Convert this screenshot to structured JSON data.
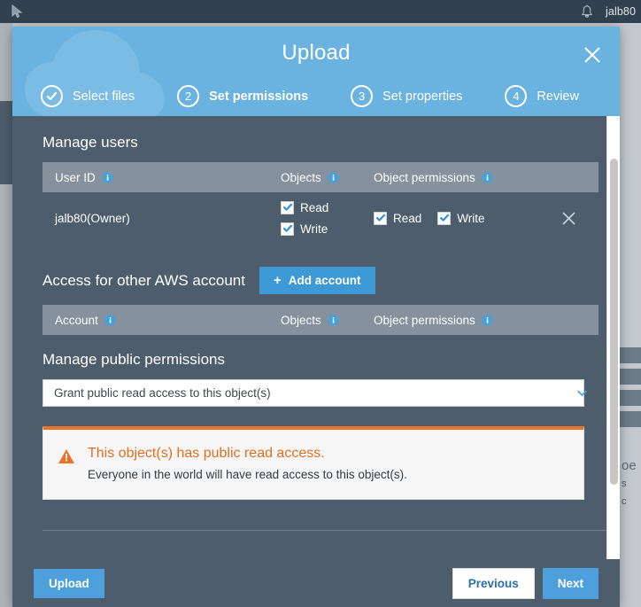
{
  "topbar": {
    "cursor_icon": "cursor-icon",
    "bell_icon": "bell-icon",
    "user": "jalb80"
  },
  "background": {
    "text_fragment_1": "oe",
    "text_fragment_2": "s",
    "text_fragment_3": "c"
  },
  "modal": {
    "title": "Upload",
    "close_icon": "close-icon",
    "watermark_icon": "cloud-upload-icon",
    "steps": [
      {
        "marker": "✓",
        "label": "Select files",
        "state": "done"
      },
      {
        "marker": "2",
        "label": "Set permissions",
        "state": "active"
      },
      {
        "marker": "3",
        "label": "Set properties",
        "state": "upcoming"
      },
      {
        "marker": "4",
        "label": "Review",
        "state": "upcoming"
      }
    ],
    "manage_users": {
      "heading": "Manage users",
      "columns": [
        "User ID",
        "Objects",
        "Object permissions"
      ],
      "rows": [
        {
          "user_id": "jalb80(Owner)",
          "objects": [
            {
              "label": "Read",
              "checked": true
            },
            {
              "label": "Write",
              "checked": true
            }
          ],
          "object_permissions": [
            {
              "label": "Read",
              "checked": true
            },
            {
              "label": "Write",
              "checked": true
            }
          ],
          "remove_icon": "close-icon"
        }
      ]
    },
    "other_account": {
      "heading": "Access for other AWS account",
      "add_button": "Add account",
      "add_button_icon": "plus-icon",
      "columns": [
        "Account",
        "Objects",
        "Object permissions"
      ]
    },
    "public_permissions": {
      "heading": "Manage public permissions",
      "selected": "Grant public read access to this object(s)",
      "caret_icon": "chevron-down-icon"
    },
    "alert": {
      "icon": "warning-triangle-icon",
      "title": "This object(s) has public read access.",
      "description": "Everyone in the world will have read access to this object(s)."
    },
    "footer": {
      "upload": "Upload",
      "previous": "Previous",
      "next": "Next"
    }
  },
  "colors": {
    "header_blue": "#6ab3e0",
    "body_slate": "#4e5d6c",
    "table_header": "#85929e",
    "accent_blue": "#4ea0dd",
    "warning_orange": "#e8742b",
    "topbar_dark": "#32414f"
  }
}
